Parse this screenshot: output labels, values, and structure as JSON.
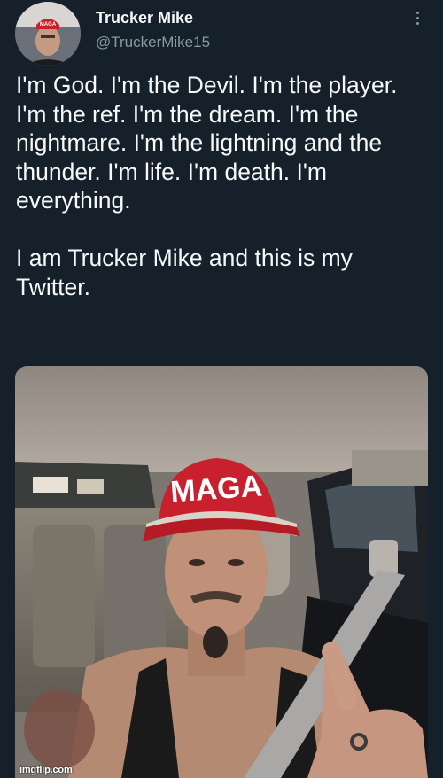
{
  "account": {
    "display_name": "Trucker Mike",
    "handle": "@TruckerMike15"
  },
  "tweet": {
    "text": "I'm God. I'm the Devil. I'm the player. I'm the ref. I'm the dream. I'm the nightmare. I'm the lightning and the thunder. I'm life. I'm death. I'm everything.\n\nI am Trucker Mike and this is my Twitter."
  },
  "media": {
    "hat_text": "MAGA",
    "avatar_hat_text": "MAGA"
  },
  "watermark": "imgflip.com",
  "icons": {
    "more": "more-vertical-icon"
  },
  "colors": {
    "background": "#15202b",
    "primary_text": "#f7f9f9",
    "secondary_text": "#8b98a5",
    "hat_red": "#c8202c"
  }
}
